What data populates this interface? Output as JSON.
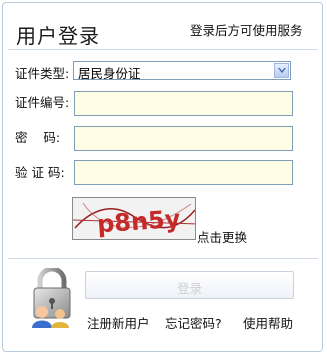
{
  "header": {
    "title": "用户登录",
    "subtitle": "登录后方可使用服务"
  },
  "form": {
    "id_type_label": "证件类型:",
    "id_type_value": "居民身份证",
    "id_number_label": "证件编号:",
    "password_label": "密    码:",
    "captcha_label": "验 证 码:",
    "captcha_text": "p8n5y",
    "refresh_label": "点击更换"
  },
  "actions": {
    "login_label": "登录",
    "register_link": "注册新用户",
    "forgot_link": "忘记密码?",
    "help_link": "使用帮助"
  },
  "colors": {
    "input_bg": "#fffde3",
    "border": "#7f9db9",
    "captcha_text": "#c42a2a"
  }
}
